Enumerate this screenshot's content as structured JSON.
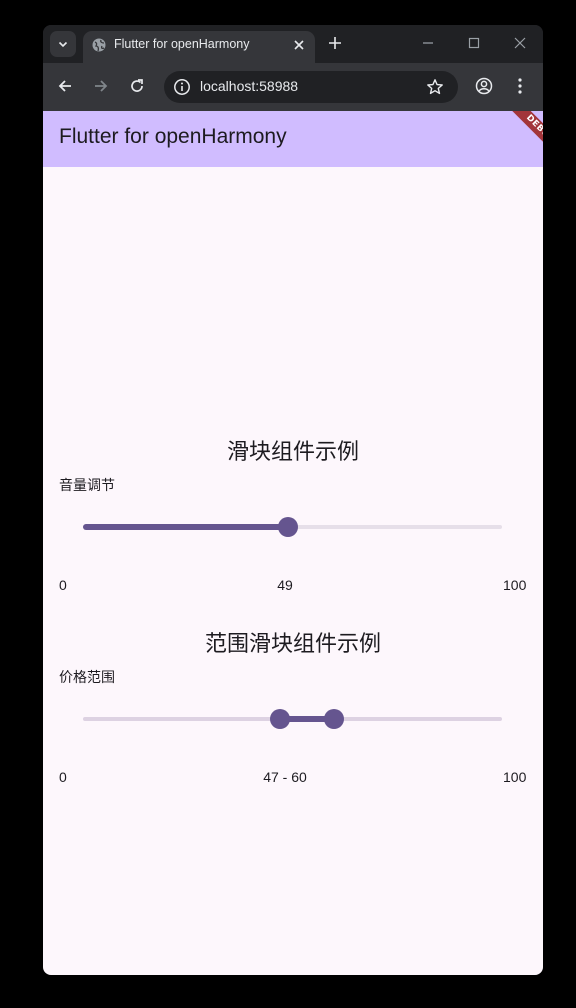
{
  "browser": {
    "tab_title": "Flutter for openHarmony",
    "url": "localhost:58988",
    "icons": {
      "tab_search": "chevron-down-icon",
      "favicon": "globe-icon",
      "close": "close-icon",
      "new_tab": "plus-icon",
      "minimize": "minimize-icon",
      "maximize": "maximize-icon",
      "window_close": "window-close-icon",
      "back": "arrow-left-icon",
      "forward": "arrow-right-icon",
      "reload": "reload-icon",
      "site_info": "info-icon",
      "bookmark": "star-icon",
      "profile": "account-icon",
      "menu": "kebab-menu-icon"
    }
  },
  "app": {
    "title": "Flutter for openHarmony",
    "debug_banner": "DEBUG",
    "colors": {
      "appbar": "#d0bcff",
      "background": "#fdf7fc",
      "primary": "#65558f",
      "track_inactive": "#e6dfe9",
      "debug_banner": "#a2353a"
    },
    "slider_section": {
      "title": "滑块组件示例",
      "label": "音量调节",
      "min_label": "0",
      "value_label": "49",
      "max_label": "100",
      "min": 0,
      "max": 100,
      "value": 49
    },
    "range_section": {
      "title": "范围滑块组件示例",
      "label": "价格范围",
      "min_label": "0",
      "value_label": "47 - 60",
      "max_label": "100",
      "min": 0,
      "max": 100,
      "start": 47,
      "end": 60
    }
  }
}
